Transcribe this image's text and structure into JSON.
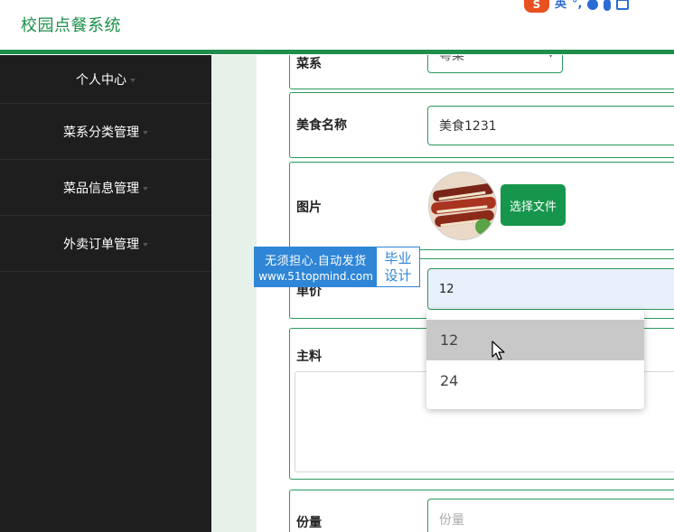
{
  "app": {
    "title": "校园点餐系统"
  },
  "ime": {
    "logo": "S",
    "lang": "英",
    "punct": "°,"
  },
  "sidebar": {
    "items": [
      {
        "label": "个人中心"
      },
      {
        "label": "菜系分类管理"
      },
      {
        "label": "菜品信息管理"
      },
      {
        "label": "外卖订单管理"
      }
    ]
  },
  "form": {
    "cuisine": {
      "label": "菜系",
      "value": "粤菜"
    },
    "food_name": {
      "label": "美食名称",
      "value": "美食1231"
    },
    "image": {
      "label": "图片",
      "button": "选择文件"
    },
    "price": {
      "label": "单价",
      "value": "12",
      "options": [
        "12",
        "24"
      ]
    },
    "ingredients": {
      "label": "主料",
      "value": ""
    },
    "portion": {
      "label": "份量",
      "placeholder": "份量"
    }
  },
  "watermark": {
    "line1": "无须担心.自动发货",
    "line2": "www.51topmind.com",
    "right_top": "毕业",
    "right_bottom": "设计"
  },
  "colors": {
    "brand_green": "#1b8f4a",
    "button_green": "#16964c",
    "sidebar_bg": "#1e1e1e",
    "watermark_blue": "#2f86d6"
  }
}
